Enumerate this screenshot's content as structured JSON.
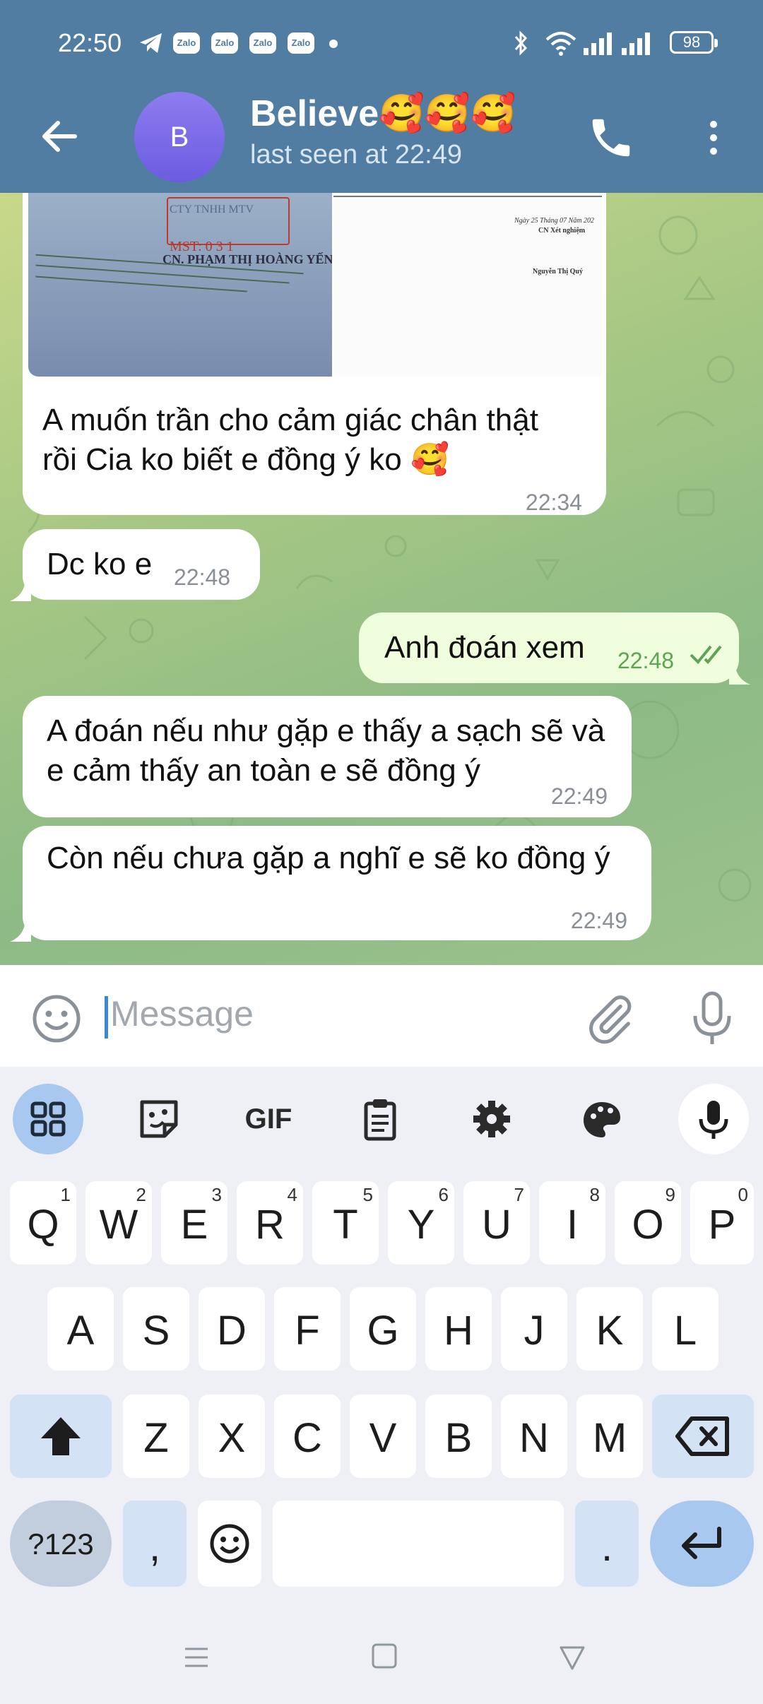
{
  "status_bar": {
    "time": "22:50",
    "zalo_labels": [
      "Zalo",
      "Zalo",
      "Zalo",
      "Zalo"
    ],
    "battery": "98"
  },
  "header": {
    "avatar_letter": "B",
    "contact_name": "Believe🥰🥰🥰",
    "last_seen": "last seen at 22:49"
  },
  "photo_text": {
    "stamp_company": "CTY TNHH MTV",
    "stamp_mst": "MST: 0 3 1",
    "stamp_person": "CN. PHẠM THỊ HOÀNG YẾN",
    "doc_date": "Ngày 25 Tháng 07 Năm 202",
    "doc_role": "CN Xét nghiệm",
    "doc_signer": "Nguyễn Thị Quý"
  },
  "messages": [
    {
      "text": "A muốn trần cho cảm giác chân thật rồi Cia ko biết e đồng ý ko 🥰",
      "time": "22:34",
      "direction": "in"
    },
    {
      "text": "Dc ko e",
      "time": "22:48",
      "direction": "in"
    },
    {
      "text": "Anh đoán xem",
      "time": "22:48",
      "direction": "out",
      "read": true
    },
    {
      "text": "A đoán nếu như gặp e thấy a sạch sẽ và e cảm thấy an toàn e sẽ đồng ý",
      "time": "22:49",
      "direction": "in"
    },
    {
      "text": "Còn nếu chưa gặp a nghĩ e sẽ ko đồng ý",
      "time": "22:49",
      "direction": "in"
    }
  ],
  "input": {
    "placeholder": "Message"
  },
  "keyboard": {
    "toolbar": {
      "gif_label": "GIF"
    },
    "row1": [
      {
        "key": "Q",
        "hint": "1"
      },
      {
        "key": "W",
        "hint": "2"
      },
      {
        "key": "E",
        "hint": "3"
      },
      {
        "key": "R",
        "hint": "4"
      },
      {
        "key": "T",
        "hint": "5"
      },
      {
        "key": "Y",
        "hint": "6"
      },
      {
        "key": "U",
        "hint": "7"
      },
      {
        "key": "I",
        "hint": "8"
      },
      {
        "key": "O",
        "hint": "9"
      },
      {
        "key": "P",
        "hint": "0"
      }
    ],
    "row2": [
      "A",
      "S",
      "D",
      "F",
      "G",
      "H",
      "J",
      "K",
      "L"
    ],
    "row3": [
      "Z",
      "X",
      "C",
      "V",
      "B",
      "N",
      "M"
    ],
    "symbols_label": "?123",
    "comma_label": ",",
    "period_label": "."
  },
  "colors": {
    "header_bg": "#517da2",
    "outgoing_bubble": "#effedd",
    "incoming_bubble": "#ffffff",
    "read_check": "#5fa354",
    "keyboard_accent": "#a8c8f0"
  }
}
